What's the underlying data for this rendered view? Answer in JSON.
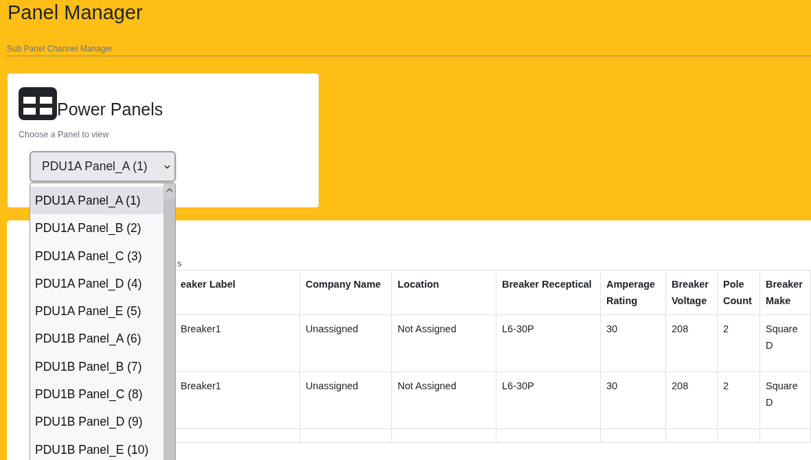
{
  "page": {
    "title": "Panel Manager",
    "subtitle": "Sub Panel Channel Manager"
  },
  "panels_card": {
    "title": "Power Panels",
    "hint": "Choose a Panel to view",
    "select": {
      "value": "PDU1A Panel_A (1)",
      "expanded": true,
      "options": [
        {
          "label": "PDU1A Panel_A (1)",
          "selected": true
        },
        {
          "label": "PDU1A Panel_B (2)",
          "selected": false
        },
        {
          "label": "PDU1A Panel_C (3)",
          "selected": false
        },
        {
          "label": "PDU1A Panel_D (4)",
          "selected": false
        },
        {
          "label": "PDU1A Panel_E (5)",
          "selected": false
        },
        {
          "label": "PDU1B Panel_A (6)",
          "selected": false
        },
        {
          "label": "PDU1B Panel_B (7)",
          "selected": false
        },
        {
          "label": "PDU1B Panel_C (8)",
          "selected": false
        },
        {
          "label": "PDU1B Panel_D (9)",
          "selected": false
        },
        {
          "label": "PDU1B Panel_E (10)",
          "selected": false
        }
      ]
    }
  },
  "breakers": {
    "caption": "s",
    "columns": [
      "eaker Label",
      "Company Name",
      "Location",
      "Breaker Receptical",
      "Amperage Rating",
      "Breaker Voltage",
      "Pole Count",
      "Breaker Make"
    ],
    "rows": [
      [
        "Breaker1",
        "Unassigned",
        "Not Assigned",
        "L6-30P",
        "30",
        "208",
        "2",
        "Square D"
      ],
      [
        "Breaker1",
        "Unassigned",
        "Not Assigned",
        "L6-30P",
        "30",
        "208",
        "2",
        "Square D"
      ]
    ]
  }
}
